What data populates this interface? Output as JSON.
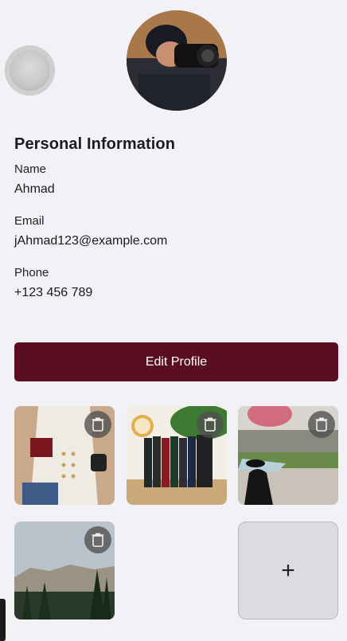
{
  "profile": {
    "section_title": "Personal Information",
    "fields": [
      {
        "label": "Name",
        "value": "Ahmad"
      },
      {
        "label": "Email",
        "value": "jAhmad123@example.com"
      },
      {
        "label": "Phone",
        "value": "+123 456 789"
      }
    ],
    "edit_button_label": "Edit Profile"
  },
  "gallery": {
    "photos": [
      {
        "subject": "outfit-flatlay"
      },
      {
        "subject": "books-and-clock"
      },
      {
        "subject": "graduation"
      },
      {
        "subject": "mountain-trees"
      }
    ],
    "delete_icon": "trash-icon",
    "add_label": "+"
  },
  "colors": {
    "background": "#f2f1f6",
    "accent": "#5a0e21",
    "button_text": "#ffffff"
  }
}
